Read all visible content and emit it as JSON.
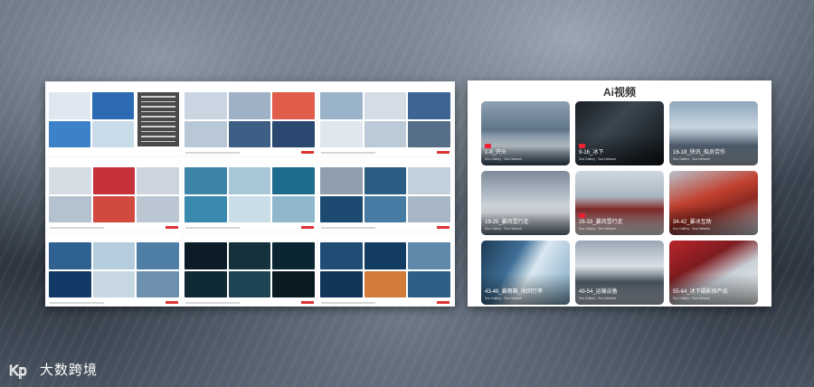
{
  "ai_panel": {
    "title": "Ai视频",
    "cards": [
      {
        "title": "1-8_开头",
        "subtitle": "Sus Gallery · Sus Network",
        "badge": true
      },
      {
        "title": "9-16_冰下",
        "subtitle": "Sus Gallery · Sus Network",
        "badge": true
      },
      {
        "title": "16-18_快讯_船员劳作",
        "subtitle": "Sus Gallery · Sus Network",
        "badge": false
      },
      {
        "title": "19-25_暴风雪行走",
        "subtitle": "Sus Gallery · Sus Network",
        "badge": false
      },
      {
        "title": "26-33_暴风雪行走",
        "subtitle": "Sus Gallery · Sus Network",
        "badge": true
      },
      {
        "title": "34-42_暴冰互助",
        "subtitle": "Sus Gallery · Sus Network",
        "badge": false
      },
      {
        "title": "43-48_暴雨箱_收回行李",
        "subtitle": "Sus Gallery · Sus Network",
        "badge": false
      },
      {
        "title": "49-54_运输设备",
        "subtitle": "Sus Gallery · Sus Network",
        "badge": false
      },
      {
        "title": "55-64_冰下摄影探产品",
        "subtitle": "Sus Gallery · Sus Network",
        "badge": false
      }
    ]
  },
  "brand": {
    "mark": "Kp",
    "name": "大数跨境"
  },
  "colors": {
    "accent_red": "#d33333",
    "panel_bg": "#ffffff"
  }
}
